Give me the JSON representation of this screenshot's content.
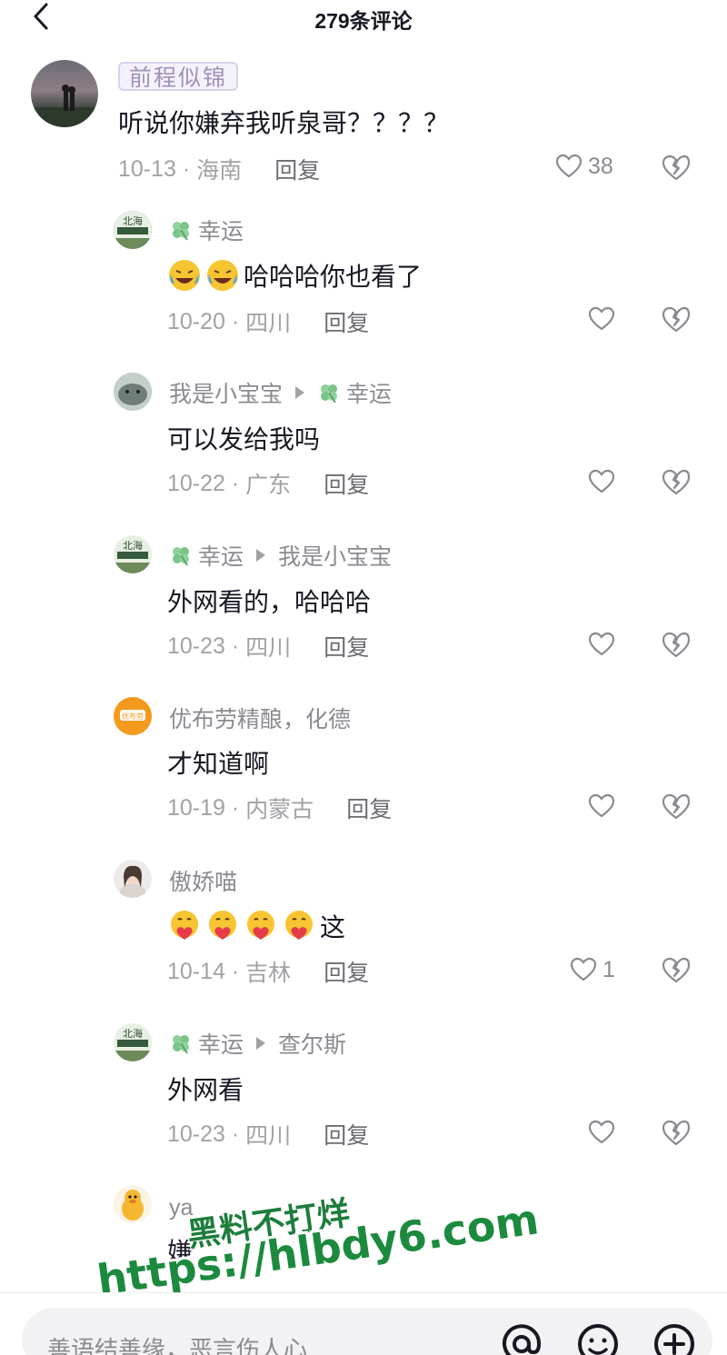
{
  "header": {
    "title": "279条评论",
    "back_icon": "chevron-left-icon"
  },
  "comments": [
    {
      "user": "前程似锦",
      "text": "听说你嫌弃我听泉哥？？？？",
      "date": "10-13",
      "location": "海南",
      "reply": "回复",
      "likes": "38"
    },
    {
      "user": "幸运",
      "text": "哈哈哈你也看了",
      "date": "10-20",
      "location": "四川",
      "reply": "回复",
      "likes": ""
    },
    {
      "user": "我是小宝宝",
      "reply_to": "幸运",
      "text": "可以发给我吗",
      "date": "10-22",
      "location": "广东",
      "reply": "回复",
      "likes": ""
    },
    {
      "user": "幸运",
      "reply_to": "我是小宝宝",
      "text": "外网看的，哈哈哈",
      "date": "10-23",
      "location": "四川",
      "reply": "回复",
      "likes": ""
    },
    {
      "user": "优布劳精酿，化德",
      "text": "才知道啊",
      "date": "10-19",
      "location": "内蒙古",
      "reply": "回复",
      "likes": ""
    },
    {
      "user": "傲娇喵",
      "text": "这",
      "date": "10-14",
      "location": "吉林",
      "reply": "回复",
      "likes": "1"
    },
    {
      "user": "幸运",
      "reply_to": "查尔斯",
      "text": "外网看",
      "date": "10-23",
      "location": "四川",
      "reply": "回复",
      "likes": ""
    },
    {
      "user": "ya",
      "text": "嫌",
      "date": "",
      "location": "",
      "reply": "",
      "likes": ""
    }
  ],
  "avatars": {
    "brand_logo_text": "优布劳"
  },
  "watermark": {
    "line1": "黑料不打烊",
    "line2": "https://hlbdy6.com"
  },
  "input_bar": {
    "placeholder": "善语结善缘，恶言伤人心",
    "icons": [
      "at-icon",
      "emoji-icon",
      "plus-icon"
    ]
  },
  "colors": {
    "primary_text": "#161823",
    "secondary_text": "#8a8b91",
    "meta_text": "#a1a2a6",
    "clover": "#7bc48a",
    "watermark": "#1c8a3e",
    "brand_orange": "#f39a1e"
  }
}
